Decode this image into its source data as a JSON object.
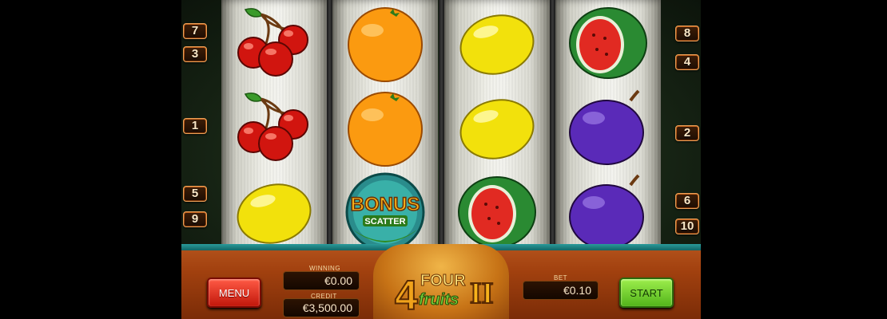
{
  "game": {
    "logo_number": "4",
    "logo_word1": "FOUR",
    "logo_word2": "fruits",
    "logo_suffix": "II"
  },
  "paylines": {
    "left": [
      "7",
      "3",
      "1",
      "5",
      "9"
    ],
    "right": [
      "8",
      "4",
      "2",
      "6",
      "10"
    ]
  },
  "reels": [
    [
      "cherry",
      "cherry",
      "lemon"
    ],
    [
      "orange",
      "orange",
      "bonus-scatter"
    ],
    [
      "lemon",
      "lemon",
      "watermelon"
    ],
    [
      "watermelon",
      "plum",
      "plum"
    ]
  ],
  "bonus": {
    "line1": "BONUS",
    "line2": "SCATTER"
  },
  "controls": {
    "menu_label": "MENU",
    "start_label": "START",
    "winning_label": "WINNING",
    "winning_value": "€0.00",
    "credit_label": "CREDIT",
    "credit_value": "€3,500.00",
    "bet_label": "BET",
    "bet_value": "€0.10"
  },
  "colors": {
    "panel": "#a2410f",
    "menu_button": "#e0301f",
    "start_button": "#7bd236",
    "badge": "#c4621d"
  }
}
